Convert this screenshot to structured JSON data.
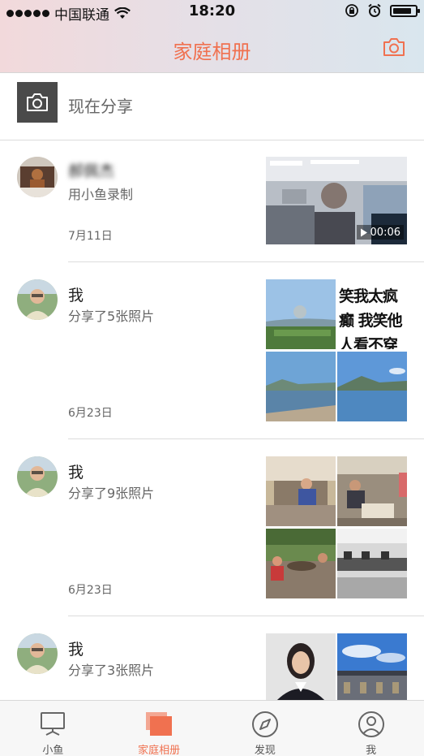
{
  "status_bar": {
    "carrier": "中国联通",
    "time": "18:20"
  },
  "header": {
    "title": "家庭相册",
    "camera_icon": "camera-icon"
  },
  "share": {
    "label": "现在分享",
    "icon": "camera-icon"
  },
  "feed": [
    {
      "name": "郝佩杰",
      "subtitle": "用小鱼录制",
      "date": "7月11日",
      "video_duration": "00:06",
      "play_icon": "play-icon"
    },
    {
      "name": "我",
      "subtitle": "分享了5张照片",
      "date": "6月23日",
      "photo_caption": "笑我太疯癫 我笑他人看不穿"
    },
    {
      "name": "我",
      "subtitle": "分享了9张照片",
      "date": "6月23日"
    },
    {
      "name": "我",
      "subtitle": "分享了3张照片"
    }
  ],
  "tabs": [
    {
      "label": "小鱼",
      "icon": "monitor-icon"
    },
    {
      "label": "家庭相册",
      "icon": "album-icon"
    },
    {
      "label": "发现",
      "icon": "compass-icon"
    },
    {
      "label": "我",
      "icon": "user-icon"
    }
  ],
  "colors": {
    "accent": "#f07150",
    "header_gradient_left": "#f2d9db",
    "header_gradient_right": "#d9e6ee",
    "share_button_bg": "#4a4a4a"
  },
  "battery_level": 0.85
}
